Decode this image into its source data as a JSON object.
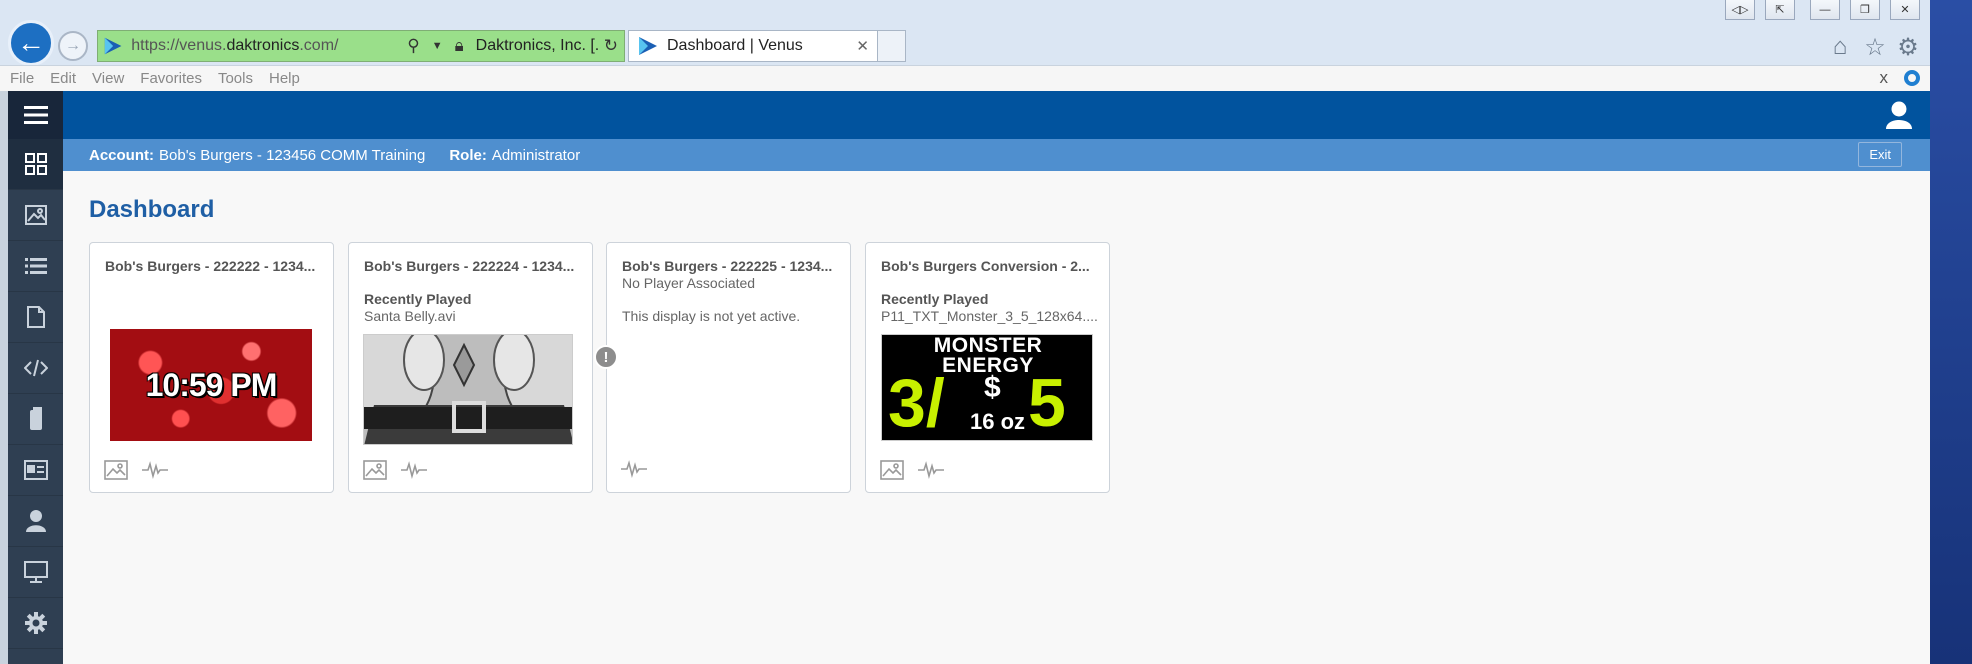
{
  "browser": {
    "url_prefix": "https://venus.",
    "url_domain": "daktronics",
    "url_suffix": ".com/",
    "cert_label": "Daktronics, Inc. [...",
    "tab_title": "Dashboard | Venus",
    "menu": [
      "File",
      "Edit",
      "View",
      "Favorites",
      "Tools",
      "Help"
    ],
    "close_glyph": "x"
  },
  "account_bar": {
    "account_label": "Account:",
    "account_value": "Bob's Burgers - 123456 COMM Training",
    "role_label": "Role:",
    "role_value": "Administrator",
    "exit_label": "Exit"
  },
  "page": {
    "title": "Dashboard"
  },
  "sidebar_icons": [
    "menu-icon",
    "dashboard-icon",
    "image-icon",
    "list-icon",
    "document-icon",
    "code-icon",
    "phone-icon",
    "id-card-icon",
    "user-icon",
    "monitor-icon",
    "gear-icon"
  ],
  "cards": [
    {
      "title": "Bob's Burgers - 222222 - 1234...",
      "thumb_text": "10:59 PM"
    },
    {
      "title": "Bob's Burgers - 222224 - 1234...",
      "recent_label": "Recently Played",
      "recent_value": "Santa Belly.avi"
    },
    {
      "title": "Bob's Burgers - 222225 - 1234...",
      "status": "No Player Associated",
      "message": "This display is not yet active.",
      "warning_glyph": "!"
    },
    {
      "title": "Bob's Burgers Conversion - 2...",
      "recent_label": "Recently Played",
      "recent_value": "P11_TXT_Monster_3_5_128x64....",
      "thumb_line1": "MONSTER",
      "thumb_line2": "ENERGY",
      "thumb_price_left": "3/",
      "thumb_price_dollar": "$",
      "thumb_price_right": "5",
      "thumb_size": "16 oz"
    }
  ],
  "colors": {
    "nav_blue": "#01539e",
    "account_bar": "#4f8fcf",
    "title_blue": "#1f5fa5",
    "sidebar": "#2f3f52",
    "address_green": "#9adf8a",
    "monster_green": "#c8f000"
  }
}
